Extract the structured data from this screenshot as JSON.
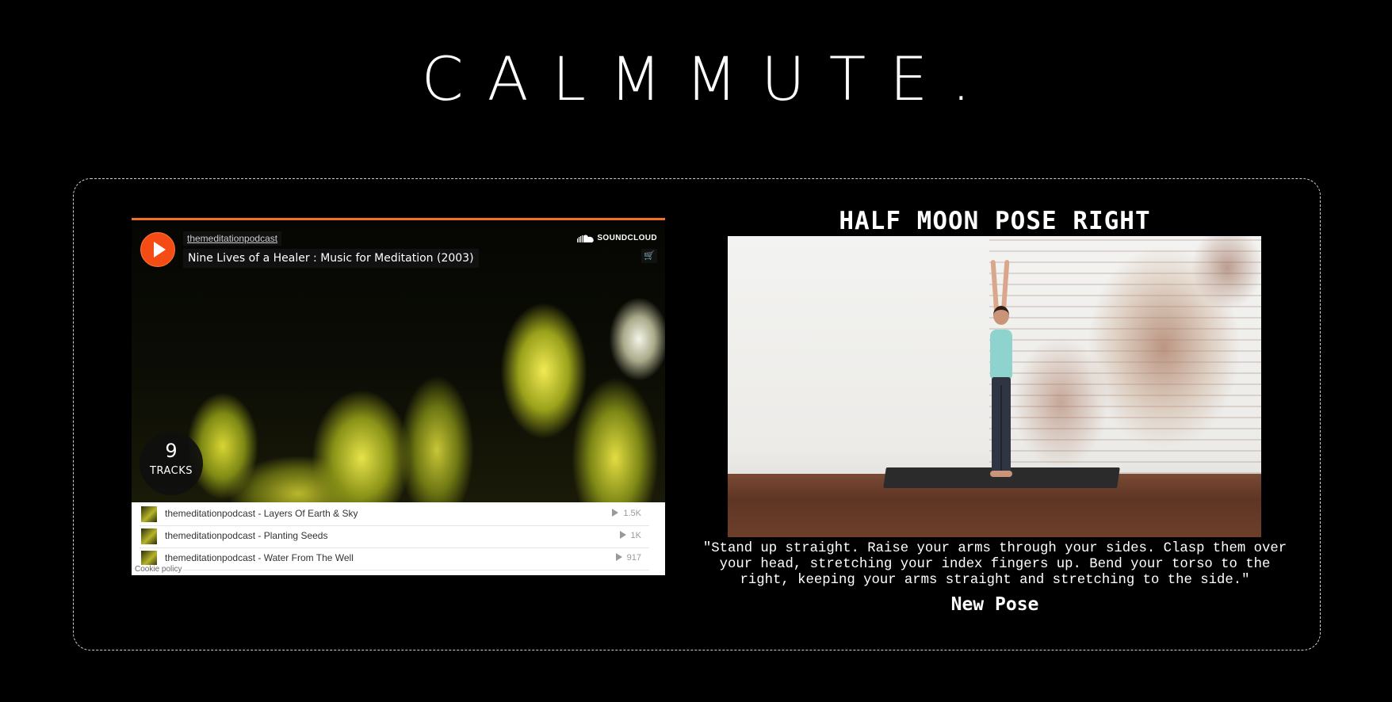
{
  "site": {
    "title": "CALMMUTE."
  },
  "player": {
    "user": "themeditationpodcast",
    "playlist_title": "Nine Lives of a Healer : Music for Meditation (2003)",
    "brand": "SOUNDCLOUD",
    "track_count": "9",
    "track_count_label": "TRACKS",
    "cookie_policy": "Cookie policy",
    "accent_color": "#f54b14",
    "tracks": [
      {
        "name": "themeditationpodcast - Layers Of Earth & Sky",
        "plays": "1.5K"
      },
      {
        "name": "themeditationpodcast - Planting Seeds",
        "plays": "1K"
      },
      {
        "name": "themeditationpodcast - Water From The Well",
        "plays": "917"
      }
    ]
  },
  "pose": {
    "title": "HALF MOON POSE RIGHT",
    "instructions": "\"Stand up straight. Raise your arms through your sides. Clasp them over your head, stretching your index fingers up. Bend your torso to the right, keeping your arms straight and stretching to the side.\"",
    "new_pose_label": "New Pose"
  }
}
